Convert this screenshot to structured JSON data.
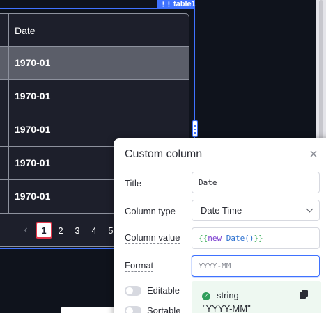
{
  "widget": {
    "name": "table1"
  },
  "table": {
    "column_header": "Date",
    "rows": [
      "1970-01",
      "1970-01",
      "1970-01",
      "1970-01",
      "1970-01"
    ],
    "selected_row": 0,
    "pagination": {
      "prev_icon": "chevron-left-icon",
      "pages": [
        "1",
        "2",
        "3",
        "4",
        "5"
      ],
      "current_page": "1"
    }
  },
  "panel": {
    "title": "Custom column",
    "close_icon": "close-icon",
    "fields": {
      "title": {
        "label": "Title",
        "value": "Date"
      },
      "column_type": {
        "label": "Column type",
        "value": "Date Time"
      },
      "column_value": {
        "label": "Column value",
        "open": "{{",
        "keyword": "new",
        "fn": "Date()",
        "close": "}}"
      },
      "format": {
        "label": "Format",
        "value": "YYYY-MM"
      }
    },
    "switches": {
      "editable": "Editable",
      "sortable": "Sortable"
    },
    "suggestion": {
      "type": "string",
      "value": "\"YYYY-MM\""
    }
  },
  "colors": {
    "accent": "#3f72ff",
    "active_page_border": "#e2374a",
    "success": "#2f9e5b"
  }
}
